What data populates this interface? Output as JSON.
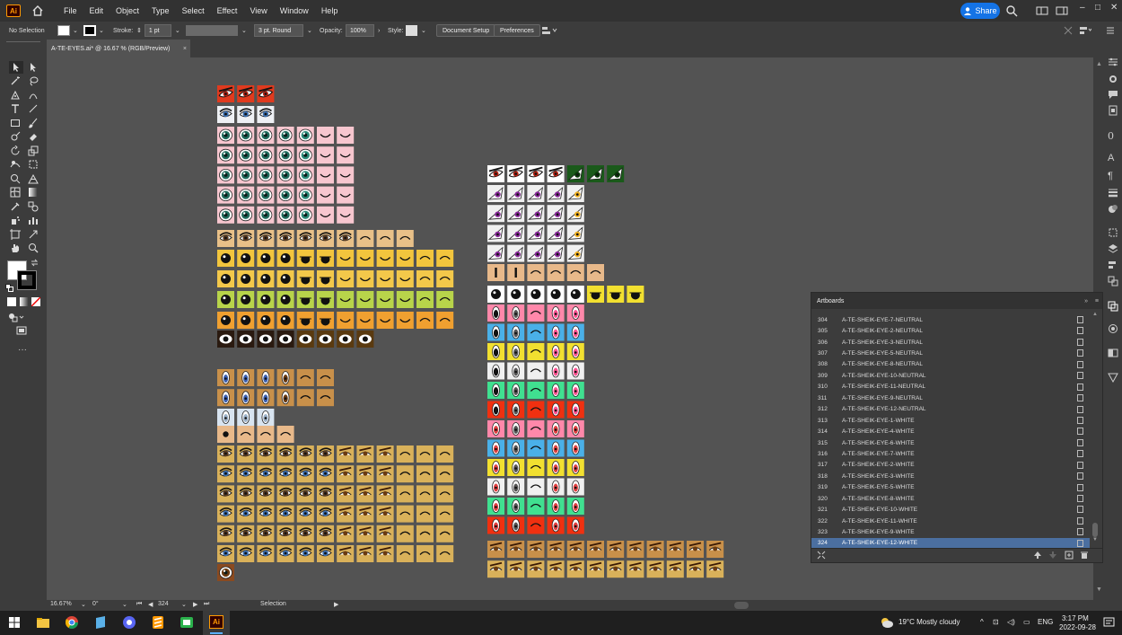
{
  "app": {
    "logo_text": "Ai"
  },
  "menu": [
    "File",
    "Edit",
    "Object",
    "Type",
    "Select",
    "Effect",
    "View",
    "Window",
    "Help"
  ],
  "share_label": "Share",
  "control_bar": {
    "selection": "No Selection",
    "stroke_label": "Stroke:",
    "stroke_value": "1 pt",
    "brush_label": "3 pt. Round",
    "opacity_label": "Opacity:",
    "opacity_value": "100%",
    "style_label": "Style:",
    "document_setup": "Document Setup",
    "preferences": "Preferences"
  },
  "document_tab": {
    "title": "A-TE-EYES.ai* @ 16.67 % (RGB/Preview)",
    "close": "×"
  },
  "status_bar": {
    "zoom": "16.67%",
    "rotation": "0°",
    "artboard": "324",
    "tool": "Selection"
  },
  "artboards_panel": {
    "title": "Artboards",
    "rows": [
      {
        "num": "304",
        "name": "A-TE-SHEIK-EYE-7-NEUTRAL"
      },
      {
        "num": "305",
        "name": "A-TE-SHEIK-EYE-2-NEUTRAL"
      },
      {
        "num": "306",
        "name": "A-TE-SHEIK-EYE-3-NEUTRAL"
      },
      {
        "num": "307",
        "name": "A-TE-SHEIK-EYE-5-NEUTRAL"
      },
      {
        "num": "308",
        "name": "A-TE-SHEIK-EYE-8-NEUTRAL"
      },
      {
        "num": "309",
        "name": "A-TE-SHEIK-EYE-10-NEUTRAL"
      },
      {
        "num": "310",
        "name": "A-TE-SHEIK-EYE-11-NEUTRAL"
      },
      {
        "num": "311",
        "name": "A-TE-SHEIK-EYE-9-NEUTRAL"
      },
      {
        "num": "312",
        "name": "A-TE-SHEIK-EYE-12-NEUTRAL"
      },
      {
        "num": "313",
        "name": "A-TE-SHEIK-EYE-1-WHITE"
      },
      {
        "num": "314",
        "name": "A-TE-SHEIK-EYE-4-WHITE"
      },
      {
        "num": "315",
        "name": "A-TE-SHEIK-EYE-6-WHITE"
      },
      {
        "num": "316",
        "name": "A-TE-SHEIK-EYE-7-WHITE"
      },
      {
        "num": "317",
        "name": "A-TE-SHEIK-EYE-2-WHITE"
      },
      {
        "num": "318",
        "name": "A-TE-SHEIK-EYE-3-WHITE"
      },
      {
        "num": "319",
        "name": "A-TE-SHEIK-EYE-5-WHITE"
      },
      {
        "num": "320",
        "name": "A-TE-SHEIK-EYE-8-WHITE"
      },
      {
        "num": "321",
        "name": "A-TE-SHEIK-EYE-10-WHITE"
      },
      {
        "num": "322",
        "name": "A-TE-SHEIK-EYE-11-WHITE"
      },
      {
        "num": "323",
        "name": "A-TE-SHEIK-EYE-9-WHITE"
      },
      {
        "num": "324",
        "name": "A-TE-SHEIK-EYE-12-WHITE"
      }
    ],
    "selected": "324"
  },
  "taskbar": {
    "weather": "19°C  Mostly cloudy",
    "lang": "ENG",
    "time": "3:17 PM",
    "date": "2022-09-28"
  },
  "colors": {
    "accent": "#1473e6",
    "artboard_red": "#e03a1e",
    "pink": "#f7c6cf",
    "teal_iris": "#1e6b5c",
    "yellow": "#f2c53d",
    "orange": "#f0a030",
    "lime": "#b8d44a",
    "skin": "#e8b98a",
    "tan": "#d9b15a",
    "purple_iris": "#8a2a9a",
    "green": "#1a5a1a"
  },
  "canvas_groups": [
    {
      "palette": "red_eye",
      "bg": "#e03a1e",
      "cols": 3
    },
    {
      "palette": "white_eye",
      "bg": "#eef0f4",
      "cols": 3
    },
    {
      "palette": "pink_teal",
      "bg": "#f7c6cf",
      "cols": 7,
      "rows": 5
    },
    {
      "palette": "tan_lids",
      "bg": "#e8c088",
      "cols": 10
    },
    {
      "palette": "yellow_dots",
      "bg": "#f2c53d",
      "cols": 12
    },
    {
      "palette": "yellow2",
      "bg": "#f3c84a",
      "cols": 12
    },
    {
      "palette": "lime",
      "bg": "#b8d44a",
      "cols": 12
    },
    {
      "palette": "orange",
      "bg": "#f0a030",
      "cols": 12
    },
    {
      "palette": "dark_whites",
      "bg": "#2a1a10",
      "cols": 8
    },
    {
      "palette": "anime_brown",
      "bg": "#c8904a",
      "cols": 6,
      "rows": 2
    },
    {
      "palette": "light_blue",
      "bg": "#d8e4f0",
      "cols": 3
    },
    {
      "palette": "skin_small",
      "bg": "#e8b98a",
      "cols": 4
    },
    {
      "palette": "tan_anime",
      "bg": "#d9b15a",
      "cols": 13,
      "rows": 6
    },
    {
      "palette": "sheik_top",
      "bg": "#ffffff",
      "cols": 7
    },
    {
      "palette": "purple",
      "bg": "#f0f0f0",
      "cols": 5,
      "rows": 4
    },
    {
      "palette": "skin_dots",
      "bg": "#e8b98a",
      "cols": 6
    },
    {
      "palette": "black_dots",
      "bg": "#f2e030",
      "cols": 8
    },
    {
      "palette": "sheik_colors",
      "bg": "#ff88aa",
      "cols": 5,
      "rows": 12
    },
    {
      "palette": "brown_sheik",
      "bg": "#c8904a",
      "cols": 12,
      "rows": 2
    }
  ]
}
